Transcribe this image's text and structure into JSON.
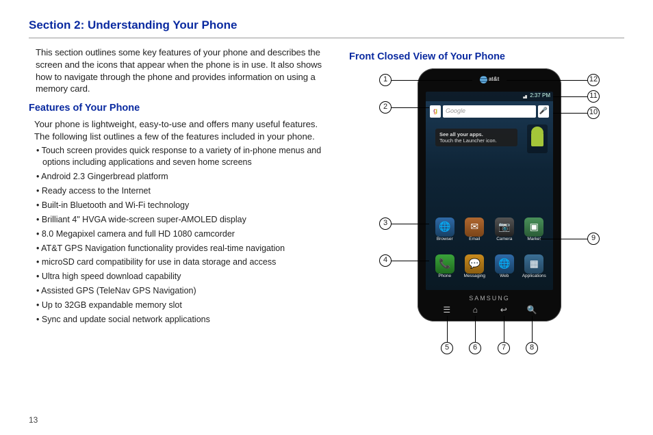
{
  "section_title": "Section 2: Understanding Your Phone",
  "intro": "This section outlines some key features of your phone and describes the screen and the icons that appear when the phone is in use. It also shows how to navigate through the phone and provides information on using a memory card.",
  "features_heading": "Features of Your Phone",
  "features_intro": "Your phone is lightweight, easy-to-use and offers many useful features. The following list outlines a few of the features included in your phone.",
  "features": [
    "Touch screen provides quick response to a variety of in-phone menus and options including applications and seven home screens",
    "Android 2.3 Gingerbread platform",
    "Ready access to the Internet",
    "Built-in Bluetooth and Wi-Fi technology",
    "Brilliant 4\" HVGA wide-screen super-AMOLED display",
    "8.0 Megapixel camera and full HD 1080 camcorder",
    "AT&T GPS Navigation functionality provides real-time navigation",
    "microSD card compatibility for use in data storage and access",
    "Ultra high speed download capability",
    "Assisted GPS (TeleNav GPS Navigation)",
    "Up to 32GB expandable memory slot",
    "Sync and update social network applications"
  ],
  "page_number": "13",
  "front_view_heading": "Front Closed View of Your Phone",
  "phone": {
    "carrier": "at&t",
    "brand": "SAMSUNG",
    "status_time": "2:37 PM",
    "search_placeholder": "Google",
    "g_letter": "g",
    "tip_title": "See all your apps.",
    "tip_body": "Touch the Launcher icon.",
    "icon_row1": [
      "Browser",
      "Email",
      "Camera",
      "Market"
    ],
    "icon_row2": [
      "Phone",
      "Messaging",
      "Web",
      "Applications"
    ],
    "soft_keys": {
      "menu": "☰",
      "home": "⌂",
      "back": "↩",
      "search": "🔍"
    }
  },
  "callouts": [
    "1",
    "2",
    "3",
    "4",
    "5",
    "6",
    "7",
    "8",
    "9",
    "10",
    "11",
    "12"
  ]
}
